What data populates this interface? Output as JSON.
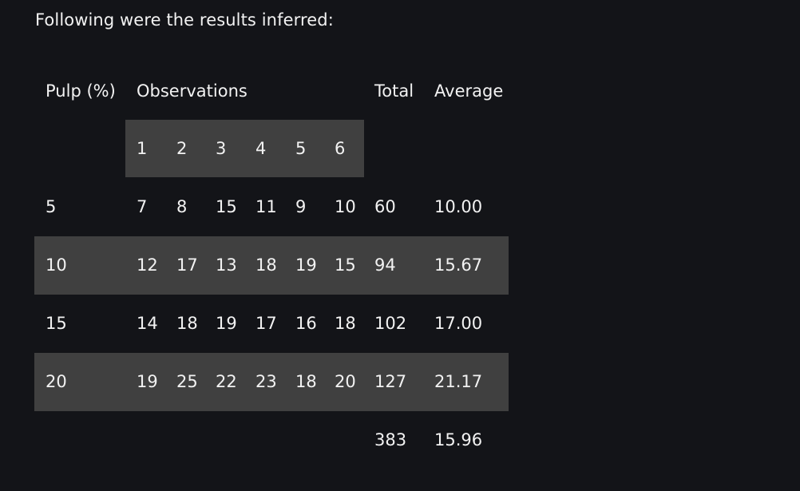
{
  "intro": "Following were the results inferred:",
  "headers": {
    "pulp": "Pulp (%)",
    "observations": "Observations",
    "total": "Total",
    "average": "Average"
  },
  "observation_numbers": [
    "1",
    "2",
    "3",
    "4",
    "5",
    "6"
  ],
  "rows": [
    {
      "pulp": "5",
      "obs": [
        "7",
        "8",
        "15",
        "11",
        "9",
        "10"
      ],
      "total": "60",
      "average": "10.00"
    },
    {
      "pulp": "10",
      "obs": [
        "12",
        "17",
        "13",
        "18",
        "19",
        "15"
      ],
      "total": "94",
      "average": "15.67"
    },
    {
      "pulp": "15",
      "obs": [
        "14",
        "18",
        "19",
        "17",
        "16",
        "18"
      ],
      "total": "102",
      "average": "17.00"
    },
    {
      "pulp": "20",
      "obs": [
        "19",
        "25",
        "22",
        "23",
        "18",
        "20"
      ],
      "total": "127",
      "average": "21.17"
    }
  ],
  "summary": {
    "total": "383",
    "average": "15.96"
  }
}
